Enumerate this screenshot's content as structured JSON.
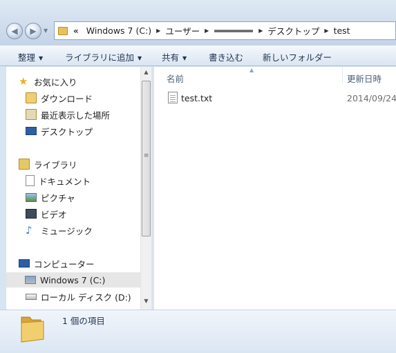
{
  "address": {
    "chevron": "«",
    "crumbs": [
      "Windows 7 (C:)",
      "ユーザー",
      "",
      "デスクトップ",
      "test"
    ]
  },
  "toolbar": {
    "organize": "整理",
    "add_to_library": "ライブラリに追加",
    "share": "共有",
    "burn": "書き込む",
    "new_folder": "新しいフォルダー"
  },
  "nav": {
    "favorites": "お気に入り",
    "downloads": "ダウンロード",
    "recent": "最近表示した場所",
    "desktop": "デスクトップ",
    "libraries": "ライブラリ",
    "documents": "ドキュメント",
    "pictures": "ピクチャ",
    "videos": "ビデオ",
    "music": "ミュージック",
    "computer": "コンピューター",
    "drive_c": "Windows 7 (C:)",
    "drive_d": "ローカル ディスク (D:)"
  },
  "columns": {
    "name": "名前",
    "date": "更新日時"
  },
  "files": [
    {
      "name": "test.txt",
      "date": "2014/09/24"
    }
  ],
  "status": {
    "text": "1 個の項目"
  }
}
